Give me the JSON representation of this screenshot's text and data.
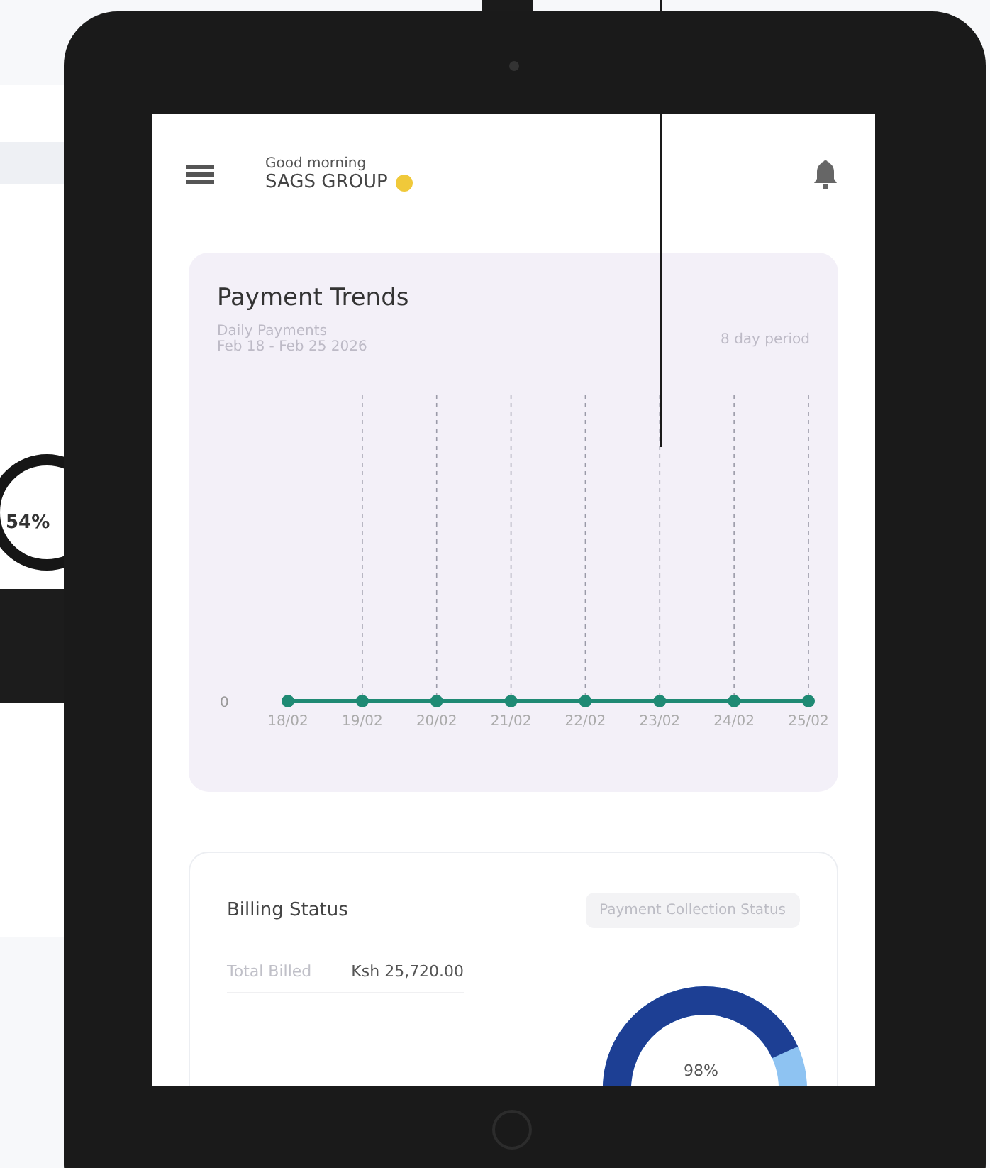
{
  "background_device": {
    "ring_label": "54%"
  },
  "header": {
    "greeting": "Good morning",
    "company": "SAGS GROUP"
  },
  "payment_trends": {
    "title": "Payment Trends",
    "subtitle": "Daily Payments",
    "date_range": "Feb 18 - Feb 25 2026",
    "period": "8 day period",
    "y_axis_label": "0",
    "x_axis_labels": [
      "18/02",
      "19/02",
      "20/02",
      "21/02",
      "22/02",
      "23/02",
      "24/02",
      "25/02"
    ]
  },
  "billing": {
    "title": "Billing Status",
    "filter": "Payment Collection Status",
    "rows": [
      {
        "label": "Total Billed",
        "value": "Ksh 25,720.00"
      }
    ],
    "donut_label": "98%"
  }
}
